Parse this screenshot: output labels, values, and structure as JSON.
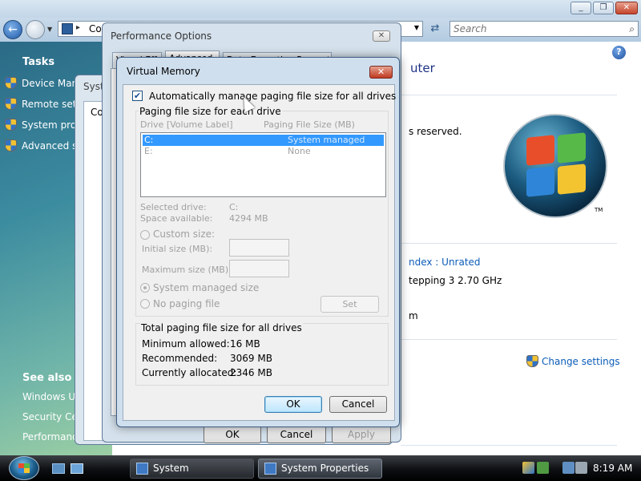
{
  "explorer": {
    "address": "Co",
    "search_placeholder": "Search",
    "sidebar": {
      "tasks_title": "Tasks",
      "tasks": [
        "Device Manager",
        "Remote settings",
        "System protection",
        "Advanced system settings"
      ],
      "see_also_title": "See also",
      "see_also": [
        "Windows Update",
        "Security Center",
        "Performance"
      ]
    },
    "content": {
      "heading": "uter",
      "rights": "s reserved.",
      "rating": "ndex : Unrated",
      "processor": "tepping 3   2.70 GHz",
      "ram": "m",
      "change_settings": "Change settings"
    }
  },
  "system_properties": {
    "title": "Syst",
    "tab_fragment": "Co"
  },
  "performance_options": {
    "title": "Performance Options",
    "tabs": [
      "Visual Effects",
      "Advanced",
      "Data Execution Prevention"
    ],
    "ok": "OK",
    "cancel": "Cancel",
    "apply": "Apply"
  },
  "virtual_memory": {
    "title": "Virtual Memory",
    "auto_manage_label": "Automatically manage paging file size for all drives",
    "auto_manage_checked": true,
    "group_label": "Paging file size for each drive",
    "col_drive": "Drive  [Volume Label]",
    "col_size": "Paging File Size (MB)",
    "drives": [
      {
        "drive": "C:",
        "size": "System managed"
      },
      {
        "drive": "E:",
        "size": "None"
      }
    ],
    "selected_drive_label": "Selected drive:",
    "selected_drive_value": "C:",
    "space_available_label": "Space available:",
    "space_available_value": "4294 MB",
    "custom_size_label": "Custom size:",
    "initial_size_label": "Initial size (MB):",
    "max_size_label": "Maximum size (MB):",
    "system_managed_label": "System managed size",
    "no_paging_label": "No paging file",
    "set_button": "Set",
    "total_title": "Total paging file size for all drives",
    "min_allowed_label": "Minimum allowed:",
    "min_allowed_value": "16 MB",
    "recommended_label": "Recommended:",
    "recommended_value": "3069 MB",
    "allocated_label": "Currently allocated:",
    "allocated_value": "2346 MB",
    "ok": "OK",
    "cancel": "Cancel"
  },
  "taskbar": {
    "buttons": [
      "System",
      "System Properties"
    ],
    "clock": "8:19 AM"
  },
  "colors": {
    "accent": "#3399ff",
    "link": "#0b5cb8"
  }
}
